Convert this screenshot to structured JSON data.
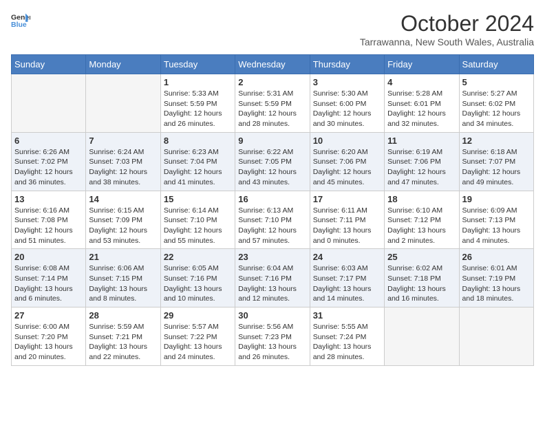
{
  "logo": {
    "line1": "General",
    "line2": "Blue"
  },
  "title": "October 2024",
  "subtitle": "Tarrawanna, New South Wales, Australia",
  "weekdays": [
    "Sunday",
    "Monday",
    "Tuesday",
    "Wednesday",
    "Thursday",
    "Friday",
    "Saturday"
  ],
  "weeks": [
    [
      {
        "day": "",
        "info": ""
      },
      {
        "day": "",
        "info": ""
      },
      {
        "day": "1",
        "sunrise": "Sunrise: 5:33 AM",
        "sunset": "Sunset: 5:59 PM",
        "daylight": "Daylight: 12 hours and 26 minutes."
      },
      {
        "day": "2",
        "sunrise": "Sunrise: 5:31 AM",
        "sunset": "Sunset: 5:59 PM",
        "daylight": "Daylight: 12 hours and 28 minutes."
      },
      {
        "day": "3",
        "sunrise": "Sunrise: 5:30 AM",
        "sunset": "Sunset: 6:00 PM",
        "daylight": "Daylight: 12 hours and 30 minutes."
      },
      {
        "day": "4",
        "sunrise": "Sunrise: 5:28 AM",
        "sunset": "Sunset: 6:01 PM",
        "daylight": "Daylight: 12 hours and 32 minutes."
      },
      {
        "day": "5",
        "sunrise": "Sunrise: 5:27 AM",
        "sunset": "Sunset: 6:02 PM",
        "daylight": "Daylight: 12 hours and 34 minutes."
      }
    ],
    [
      {
        "day": "6",
        "sunrise": "Sunrise: 6:26 AM",
        "sunset": "Sunset: 7:02 PM",
        "daylight": "Daylight: 12 hours and 36 minutes."
      },
      {
        "day": "7",
        "sunrise": "Sunrise: 6:24 AM",
        "sunset": "Sunset: 7:03 PM",
        "daylight": "Daylight: 12 hours and 38 minutes."
      },
      {
        "day": "8",
        "sunrise": "Sunrise: 6:23 AM",
        "sunset": "Sunset: 7:04 PM",
        "daylight": "Daylight: 12 hours and 41 minutes."
      },
      {
        "day": "9",
        "sunrise": "Sunrise: 6:22 AM",
        "sunset": "Sunset: 7:05 PM",
        "daylight": "Daylight: 12 hours and 43 minutes."
      },
      {
        "day": "10",
        "sunrise": "Sunrise: 6:20 AM",
        "sunset": "Sunset: 7:06 PM",
        "daylight": "Daylight: 12 hours and 45 minutes."
      },
      {
        "day": "11",
        "sunrise": "Sunrise: 6:19 AM",
        "sunset": "Sunset: 7:06 PM",
        "daylight": "Daylight: 12 hours and 47 minutes."
      },
      {
        "day": "12",
        "sunrise": "Sunrise: 6:18 AM",
        "sunset": "Sunset: 7:07 PM",
        "daylight": "Daylight: 12 hours and 49 minutes."
      }
    ],
    [
      {
        "day": "13",
        "sunrise": "Sunrise: 6:16 AM",
        "sunset": "Sunset: 7:08 PM",
        "daylight": "Daylight: 12 hours and 51 minutes."
      },
      {
        "day": "14",
        "sunrise": "Sunrise: 6:15 AM",
        "sunset": "Sunset: 7:09 PM",
        "daylight": "Daylight: 12 hours and 53 minutes."
      },
      {
        "day": "15",
        "sunrise": "Sunrise: 6:14 AM",
        "sunset": "Sunset: 7:10 PM",
        "daylight": "Daylight: 12 hours and 55 minutes."
      },
      {
        "day": "16",
        "sunrise": "Sunrise: 6:13 AM",
        "sunset": "Sunset: 7:10 PM",
        "daylight": "Daylight: 12 hours and 57 minutes."
      },
      {
        "day": "17",
        "sunrise": "Sunrise: 6:11 AM",
        "sunset": "Sunset: 7:11 PM",
        "daylight": "Daylight: 13 hours and 0 minutes."
      },
      {
        "day": "18",
        "sunrise": "Sunrise: 6:10 AM",
        "sunset": "Sunset: 7:12 PM",
        "daylight": "Daylight: 13 hours and 2 minutes."
      },
      {
        "day": "19",
        "sunrise": "Sunrise: 6:09 AM",
        "sunset": "Sunset: 7:13 PM",
        "daylight": "Daylight: 13 hours and 4 minutes."
      }
    ],
    [
      {
        "day": "20",
        "sunrise": "Sunrise: 6:08 AM",
        "sunset": "Sunset: 7:14 PM",
        "daylight": "Daylight: 13 hours and 6 minutes."
      },
      {
        "day": "21",
        "sunrise": "Sunrise: 6:06 AM",
        "sunset": "Sunset: 7:15 PM",
        "daylight": "Daylight: 13 hours and 8 minutes."
      },
      {
        "day": "22",
        "sunrise": "Sunrise: 6:05 AM",
        "sunset": "Sunset: 7:16 PM",
        "daylight": "Daylight: 13 hours and 10 minutes."
      },
      {
        "day": "23",
        "sunrise": "Sunrise: 6:04 AM",
        "sunset": "Sunset: 7:16 PM",
        "daylight": "Daylight: 13 hours and 12 minutes."
      },
      {
        "day": "24",
        "sunrise": "Sunrise: 6:03 AM",
        "sunset": "Sunset: 7:17 PM",
        "daylight": "Daylight: 13 hours and 14 minutes."
      },
      {
        "day": "25",
        "sunrise": "Sunrise: 6:02 AM",
        "sunset": "Sunset: 7:18 PM",
        "daylight": "Daylight: 13 hours and 16 minutes."
      },
      {
        "day": "26",
        "sunrise": "Sunrise: 6:01 AM",
        "sunset": "Sunset: 7:19 PM",
        "daylight": "Daylight: 13 hours and 18 minutes."
      }
    ],
    [
      {
        "day": "27",
        "sunrise": "Sunrise: 6:00 AM",
        "sunset": "Sunset: 7:20 PM",
        "daylight": "Daylight: 13 hours and 20 minutes."
      },
      {
        "day": "28",
        "sunrise": "Sunrise: 5:59 AM",
        "sunset": "Sunset: 7:21 PM",
        "daylight": "Daylight: 13 hours and 22 minutes."
      },
      {
        "day": "29",
        "sunrise": "Sunrise: 5:57 AM",
        "sunset": "Sunset: 7:22 PM",
        "daylight": "Daylight: 13 hours and 24 minutes."
      },
      {
        "day": "30",
        "sunrise": "Sunrise: 5:56 AM",
        "sunset": "Sunset: 7:23 PM",
        "daylight": "Daylight: 13 hours and 26 minutes."
      },
      {
        "day": "31",
        "sunrise": "Sunrise: 5:55 AM",
        "sunset": "Sunset: 7:24 PM",
        "daylight": "Daylight: 13 hours and 28 minutes."
      },
      {
        "day": "",
        "info": ""
      },
      {
        "day": "",
        "info": ""
      }
    ]
  ]
}
